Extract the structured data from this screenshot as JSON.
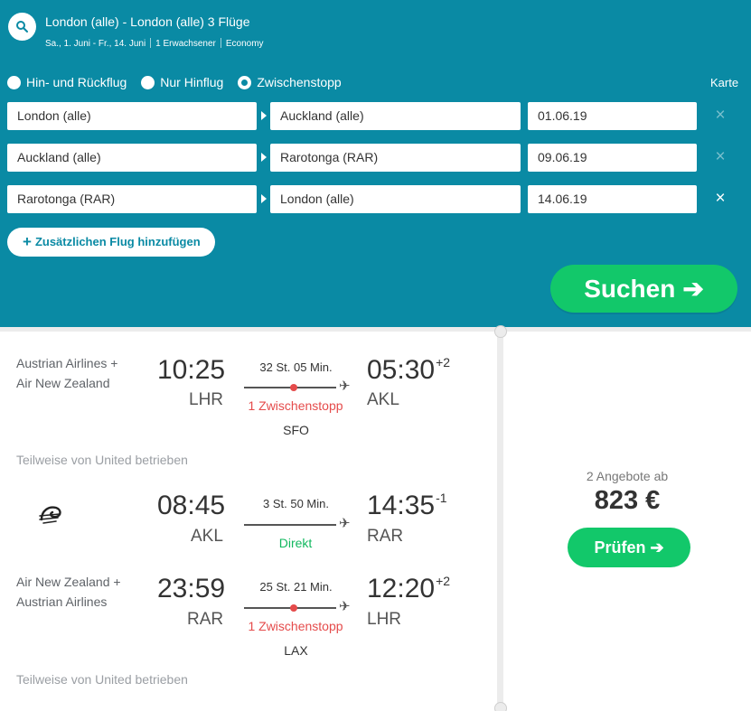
{
  "header": {
    "title": "London (alle) - London (alle) 3 Flüge",
    "dates": "Sa., 1. Juni - Fr., 14. Juni",
    "travelers": "1 Erwachsener",
    "cabin": "Economy",
    "search_icon": "search-icon"
  },
  "trip_types": [
    {
      "label": "Hin- und Rückflug",
      "selected": false
    },
    {
      "label": "Nur Hinflug",
      "selected": false
    },
    {
      "label": "Zwischenstopp",
      "selected": true
    }
  ],
  "map_label": "Karte",
  "legs": [
    {
      "origin": "London (alle)",
      "destination": "Auckland (alle)",
      "date": "01.06.19",
      "remove": "×"
    },
    {
      "origin": "Auckland (alle)",
      "destination": "Rarotonga (RAR)",
      "date": "09.06.19",
      "remove": "×"
    },
    {
      "origin": "Rarotonga (RAR)",
      "destination": "London (alle)",
      "date": "14.06.19",
      "remove": "×"
    }
  ],
  "add_flight": {
    "icon": "+",
    "label": "Zusätzlichen Flug hinzufügen"
  },
  "search_button": {
    "label": "Suchen",
    "arrow": "➔"
  },
  "result": {
    "flights": [
      {
        "airline": "Austrian Airlines + Air New Zealand",
        "depart_time": "10:25",
        "depart_code": "LHR",
        "duration": "32 St. 05 Min.",
        "stops": "1 Zwischenstopp",
        "via": "SFO",
        "arrive_time": "05:30",
        "arrive_offset": "+2",
        "arrive_code": "AKL",
        "operated": "Teilweise von United betrieben"
      },
      {
        "airline_logo": "air-new-zealand-koru-logo",
        "depart_time": "08:45",
        "depart_code": "AKL",
        "duration": "3 St. 50 Min.",
        "stops": "Direkt",
        "arrive_time": "14:35",
        "arrive_offset": "-1",
        "arrive_code": "RAR"
      },
      {
        "airline": "Air New Zealand + Austrian Airlines",
        "depart_time": "23:59",
        "depart_code": "RAR",
        "duration": "25 St. 21 Min.",
        "stops": "1 Zwischenstopp",
        "via": "LAX",
        "arrive_time": "12:20",
        "arrive_offset": "+2",
        "arrive_code": "LHR",
        "operated": "Teilweise von United betrieben"
      }
    ],
    "offers_label": "2 Angebote ab",
    "price": "823 €",
    "check_button": {
      "label": "Prüfen",
      "arrow": "➔"
    }
  },
  "colors": {
    "panel_blue": "#0a8aa4",
    "accent_green": "#12c86a",
    "stop_red": "#e54b4b",
    "direct_green": "#12b85f"
  }
}
